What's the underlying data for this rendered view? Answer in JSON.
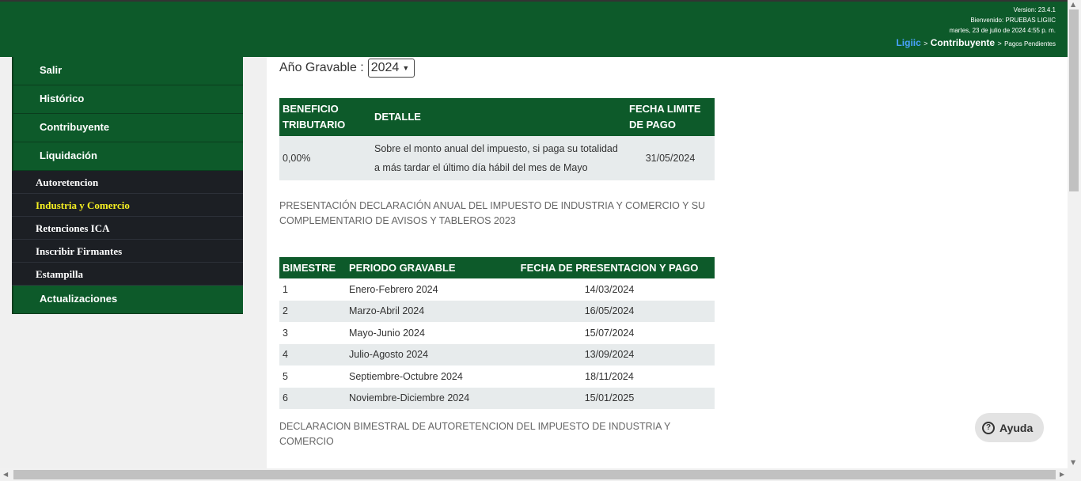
{
  "header": {
    "version": "Version: 23.4.1",
    "welcome": "Bienvenido: PRUEBAS LIGIIC",
    "datetime": "martes, 23 de julio de 2024 4:55 p. m.",
    "breadcrumb": [
      "Ligiic",
      "Contribuyente",
      "Pagos Pendientes"
    ],
    "breadcrumb_sep": ">"
  },
  "sidebar": {
    "items_top": [
      "Salir",
      "Histórico",
      "Contribuyente",
      "Liquidación"
    ],
    "subitems": [
      "Autoretencion",
      "Industria y Comercio",
      "Retenciones ICA",
      "Inscribir Firmantes",
      "Estampilla"
    ],
    "active_subitem": "Industria y Comercio",
    "items_bottom": [
      "Actualizaciones"
    ]
  },
  "main": {
    "year_label": "Año Gravable :",
    "year_value": "2024",
    "benefit_table": {
      "headers": [
        "BENEFICIO TRIBUTARIO",
        "DETALLE",
        "FECHA LIMITE DE PAGO"
      ],
      "rows": [
        [
          "0,00%",
          "Sobre el monto anual del impuesto, si paga su totalidad a más tardar el último día hábil del mes de Mayo",
          "31/05/2024"
        ]
      ]
    },
    "note1": "PRESENTACIÓN DECLARACIÓN ANUAL DEL IMPUESTO DE INDUSTRIA Y COMERCIO Y SU COMPLEMENTARIO DE AVISOS Y TABLEROS 2023",
    "bimestre_table": {
      "headers": [
        "BIMESTRE",
        "PERIODO GRAVABLE",
        "FECHA DE PRESENTACION Y PAGO"
      ],
      "rows": [
        [
          "1",
          "Enero-Febrero 2024",
          "14/03/2024"
        ],
        [
          "2",
          "Marzo-Abril 2024",
          "16/05/2024"
        ],
        [
          "3",
          "Mayo-Junio 2024",
          "15/07/2024"
        ],
        [
          "4",
          "Julio-Agosto 2024",
          "13/09/2024"
        ],
        [
          "5",
          "Septiembre-Octubre 2024",
          "18/11/2024"
        ],
        [
          "6",
          "Noviembre-Diciembre 2024",
          "15/01/2025"
        ]
      ]
    },
    "note2": "DECLARACION BIMESTRAL DE AUTORETENCION DEL IMPUESTO DE INDUSTRIA Y COMERCIO"
  },
  "help": {
    "label": "Ayuda",
    "icon": "question-circle-icon"
  },
  "colors": {
    "header_green": "#0d5a2a",
    "submenu_dark": "#1c1f24",
    "active_yellow": "#f5ef22",
    "link_blue": "#4aa3ff"
  }
}
